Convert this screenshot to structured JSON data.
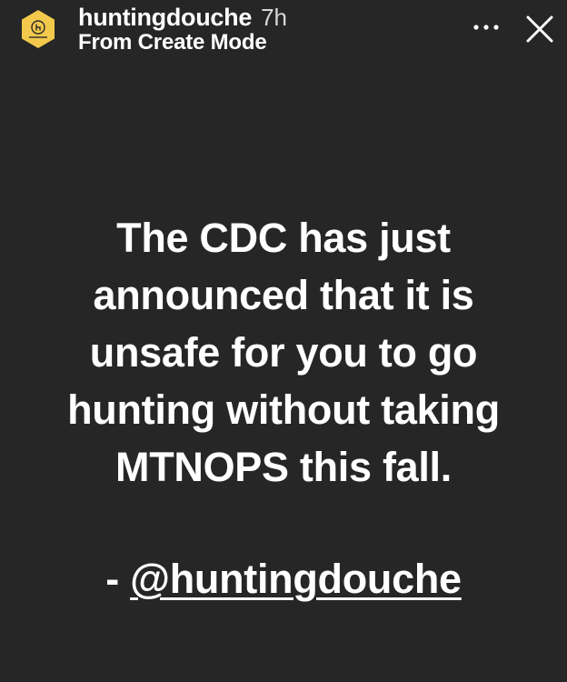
{
  "header": {
    "username": "huntingdouche",
    "time_ago": "7h",
    "subtitle": "From Create Mode",
    "avatar_icon": "hunting-douche-logo-icon",
    "more_icon": "more-options-icon",
    "close_icon": "close-icon"
  },
  "story": {
    "lines": [
      "The CDC has just",
      "announced that it is",
      "unsafe for you to go",
      "hunting without taking",
      "MTNOPS this fall."
    ],
    "signature_prefix": "- ",
    "mention": "@huntingdouche"
  },
  "colors": {
    "background": "#262626",
    "avatar_fill": "#f2c94c",
    "text": "#ffffff"
  }
}
